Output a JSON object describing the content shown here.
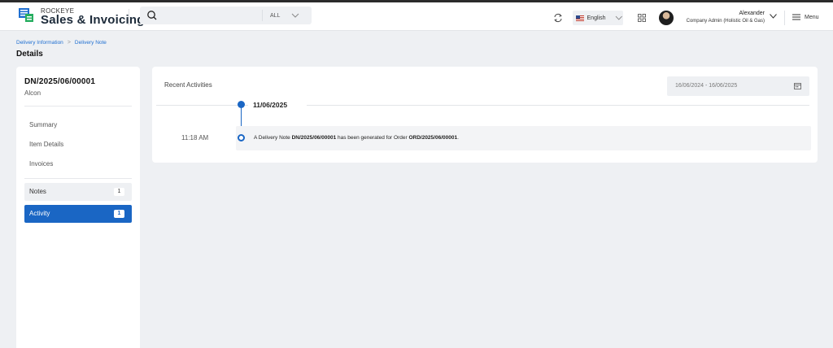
{
  "header": {
    "brand_top": "ROCKEYE",
    "brand_main": "Sales & Invoicing",
    "search_placeholder": "",
    "search_scope": "ALL",
    "language": "English",
    "user_name": "Alexander",
    "user_role": "Company Admin (Holistic Oil & Gas)",
    "menu_label": "Menu"
  },
  "breadcrumb": {
    "items": [
      "Delivery Information",
      "Delivery Note"
    ],
    "separator": ">"
  },
  "page_title": "Details",
  "sidebar": {
    "doc_number": "DN/2025/06/00001",
    "doc_sub": "Alcon",
    "nav": [
      "Summary",
      "Item Details",
      "Invoices"
    ],
    "notes": {
      "label": "Notes",
      "count": "1"
    },
    "activity": {
      "label": "Activity",
      "count": "1"
    }
  },
  "activity": {
    "title": "Recent Activities",
    "date_range": "16/06/2024 - 16/06/2025",
    "date": "11/06/2025",
    "event": {
      "time": "11:18 AM",
      "prefix": "A Delivery Note ",
      "doc": "DN/2025/06/00001",
      "middle": " has been generated for Order ",
      "order": "ORD/2025/06/00001",
      "suffix": "."
    }
  },
  "colors": {
    "accent": "#1a66c4",
    "link": "#1f6fd1",
    "background": "#eef0f3"
  }
}
